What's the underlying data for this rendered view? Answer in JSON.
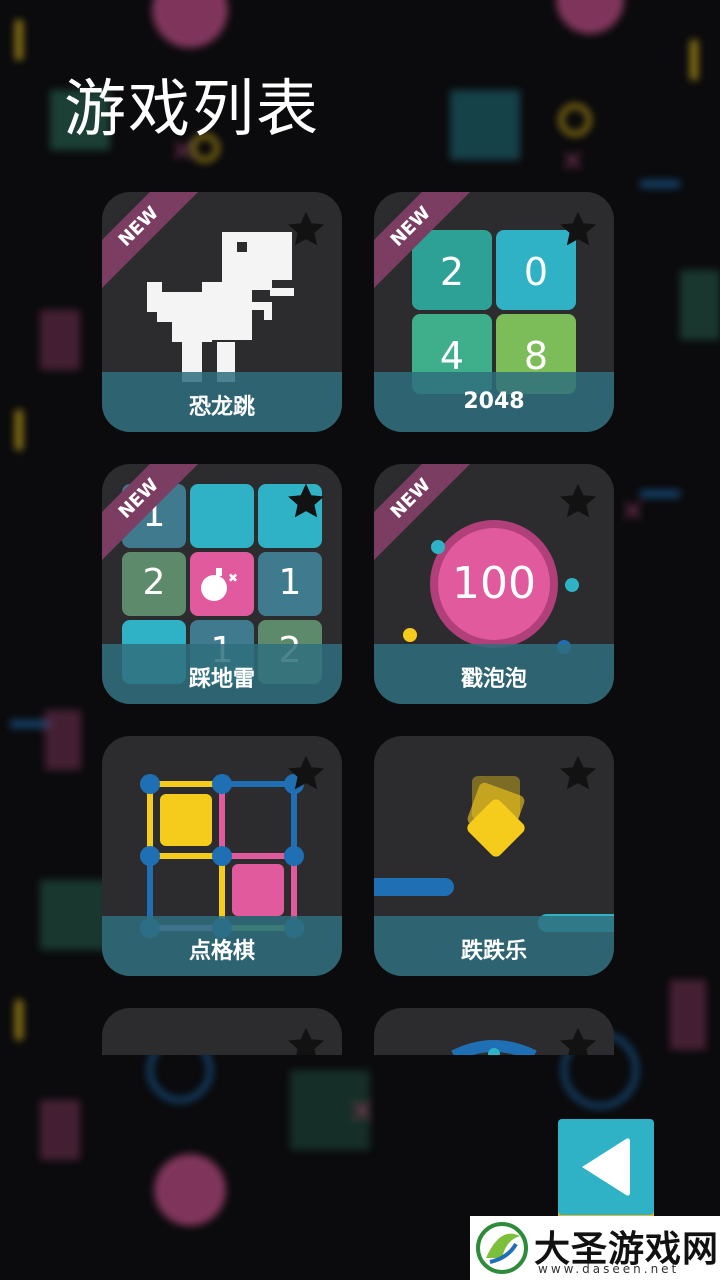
{
  "page": {
    "title": "游戏列表"
  },
  "games": [
    {
      "id": "dino",
      "label": "恐龙跳",
      "is_new": true,
      "badge": "NEW",
      "favorite_icon": "star-icon"
    },
    {
      "id": "2048",
      "label": "2048",
      "is_new": true,
      "badge": "NEW",
      "favorite_icon": "star-icon",
      "tiles": [
        "2",
        "0",
        "4",
        "8"
      ]
    },
    {
      "id": "minesweeper",
      "label": "踩地雷",
      "is_new": true,
      "badge": "NEW",
      "favorite_icon": "star-icon",
      "cells": [
        "1",
        "",
        "",
        "2",
        "bomb",
        "1",
        "",
        "1",
        "2"
      ]
    },
    {
      "id": "bubbles",
      "label": "戳泡泡",
      "is_new": true,
      "badge": "NEW",
      "favorite_icon": "star-icon",
      "score": "100"
    },
    {
      "id": "dots",
      "label": "点格棋",
      "is_new": false,
      "favorite_icon": "star-icon"
    },
    {
      "id": "jump",
      "label": "跌跌乐",
      "is_new": false,
      "favorite_icon": "star-icon"
    }
  ],
  "back_button": {
    "icon": "triangle-left-icon"
  },
  "watermark": {
    "text": "大圣游戏网",
    "url": "www.daseen.net",
    "icon": "daseen-logo-icon"
  },
  "colors": {
    "teal": "#2fb2c6",
    "pink": "#e05a9d",
    "yellow": "#f6cc1c",
    "blue": "#1f6fb5",
    "card": "#2c2c2e",
    "label_band": "#2f6f7d",
    "ribbon": "#7b3e62"
  }
}
